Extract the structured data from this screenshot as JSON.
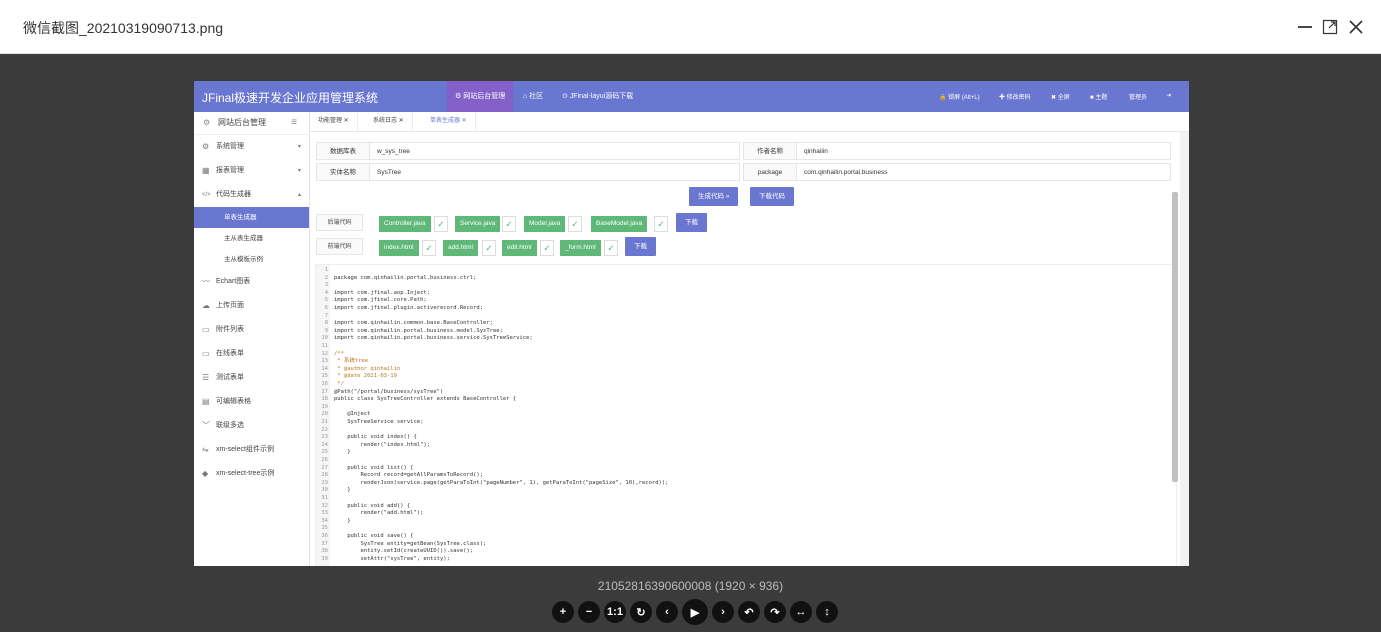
{
  "window": {
    "title": "微信截图_20210319090713.png"
  },
  "viewer": {
    "caption": "21052816390600008 (1920 × 936)",
    "tools": [
      {
        "icon": "zoom-in-icon",
        "glyph": "+"
      },
      {
        "icon": "zoom-out-icon",
        "glyph": "−"
      },
      {
        "icon": "actual-size-icon",
        "glyph": "1:1"
      },
      {
        "icon": "reset-icon",
        "glyph": "↻"
      },
      {
        "icon": "previous-icon",
        "glyph": "‹"
      },
      {
        "icon": "play-icon",
        "glyph": "▶"
      },
      {
        "icon": "next-icon",
        "glyph": "›"
      },
      {
        "icon": "rotate-left-icon",
        "glyph": "↶"
      },
      {
        "icon": "rotate-right-icon",
        "glyph": "↷"
      },
      {
        "icon": "flip-horizontal-icon",
        "glyph": "↔"
      },
      {
        "icon": "flip-vertical-icon",
        "glyph": "↕"
      }
    ]
  },
  "app": {
    "brand": "JFinal极速开发企业应用管理系统",
    "nav": [
      {
        "label": "⚙ 网站后台管理",
        "active": true
      },
      {
        "label": "⌂ 社区",
        "active": false
      },
      {
        "label": "⊙ JFinal-layui源码下载",
        "active": false
      }
    ],
    "right_nav": [
      "🔒 锁屏 (Alt+L)",
      "✚ 修改密码",
      "✖ 全屏",
      "■ 主题",
      "管理员",
      "⇥"
    ],
    "sidebar": {
      "header": "网站后台管理",
      "items": [
        {
          "label": "系统管理",
          "icon": "⚙",
          "arrow": "▾"
        },
        {
          "label": "报表管理",
          "icon": "▦",
          "arrow": "▾"
        },
        {
          "label": "代码生成器",
          "icon": "</>",
          "arrow": "▴"
        }
      ],
      "subitems": [
        {
          "label": "单表生成器",
          "active": true
        },
        {
          "label": "主从表生成器",
          "active": false
        },
        {
          "label": "主从模板示例",
          "active": false
        }
      ],
      "more": [
        {
          "label": "Echart图表",
          "icon": "〰"
        },
        {
          "label": "上传页面",
          "icon": "☁"
        },
        {
          "label": "附件列表",
          "icon": "▭"
        },
        {
          "label": "在线表单",
          "icon": "▭"
        },
        {
          "label": "测试表单",
          "icon": "☰"
        },
        {
          "label": "可编辑表格",
          "icon": "▤"
        },
        {
          "label": "联级多选",
          "icon": "﹀"
        },
        {
          "label": "xm-select组件示例",
          "icon": "⇋"
        },
        {
          "label": "xm-select-tree示例",
          "icon": "◆"
        }
      ]
    },
    "tabs": [
      {
        "label": "功能管理  ✕",
        "active": false
      },
      {
        "label": "系统日志  ✕",
        "active": false
      },
      {
        "label": "单表生成器  ✕",
        "active": true
      }
    ],
    "form": {
      "db_table_label": "数据库表",
      "db_table_value": "w_sys_tree",
      "entity_label": "实体名称",
      "entity_value": "SysTree",
      "author_label": "作者名称",
      "author_value": "qinhailin",
      "package_label": "package",
      "package_value": "com.qinhailin.portal.business"
    },
    "buttons": {
      "generate": "生成代码 »",
      "download_code": "下载代码",
      "download": "下载"
    },
    "backend": {
      "label": "后端代码",
      "files": [
        "Controller.java",
        "Service.java",
        "Model.java",
        "BaseModel.java"
      ]
    },
    "frontend": {
      "label": "前端代码",
      "files": [
        "index.html",
        "add.html",
        "edit.html",
        "_form.html"
      ]
    },
    "code_lines": [
      "",
      "package com.qinhailin.portal.business.ctrl;",
      "",
      "import com.jfinal.aop.Inject;",
      "import com.jfinal.core.Path;",
      "import com.jfinal.plugin.activerecord.Record;",
      "",
      "import com.qinhailin.common.base.BaseController;",
      "import com.qinhailin.portal.business.model.SysTree;",
      "import com.qinhailin.portal.business.service.SysTreeService;",
      "",
      "/**",
      " * 系统tree",
      " * @author qinhailin",
      " * @date 2021-03-19",
      " */",
      "@Path(\"/portal/business/sysTree\")",
      "public class SysTreeController extends BaseController {",
      "",
      "    @Inject",
      "    SysTreeService service;",
      "",
      "    public void index() {",
      "        render(\"index.html\");",
      "    }",
      "",
      "    public void list() {",
      "        Record record=getAllParamsToRecord();",
      "        renderJson(service.page(getParaToInt(\"pageNumber\", 1), getParaToInt(\"pageSize\", 10),record));",
      "    }",
      "",
      "    public void add() {",
      "        render(\"add.html\");",
      "    }",
      "",
      "    public void save() {",
      "        SysTree entity=getBean(SysTree.class);",
      "        entity.setId(createUUID()).save();",
      "        setAttr(\"sysTree\", entity);"
    ]
  }
}
